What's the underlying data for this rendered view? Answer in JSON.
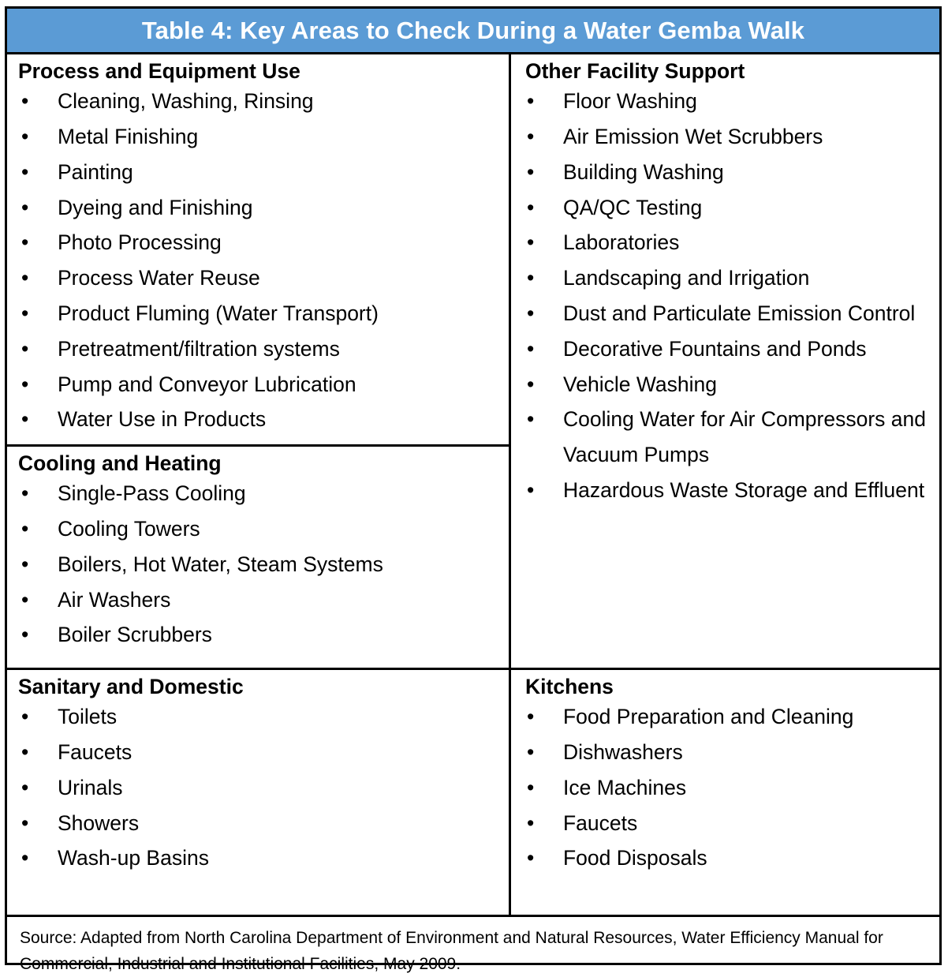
{
  "table": {
    "header": {
      "title": "Table 4: Key Areas to Check During a Water Gemba Walk",
      "background_color": "#5B9BD5",
      "text_color": "#FFFFFF"
    },
    "border_color": "#000000",
    "left_column": [
      {
        "heading": "Process and Equipment Use",
        "items": [
          "Cleaning, Washing, Rinsing",
          "Metal Finishing",
          "Painting",
          "Dyeing and Finishing",
          "Photo Processing",
          "Process Water Reuse",
          "Product Fluming (Water Transport)",
          "Pretreatment/filtration systems",
          "Pump and Conveyor Lubrication",
          "Water Use in Products"
        ]
      },
      {
        "heading": "Cooling and Heating",
        "items": [
          "Single-Pass Cooling",
          "Cooling Towers",
          "Boilers, Hot Water, Steam Systems",
          "Air Washers",
          "Boiler Scrubbers"
        ]
      },
      {
        "heading": "Sanitary and Domestic",
        "items": [
          "Toilets",
          "Faucets",
          "Urinals",
          "Showers",
          "Wash-up Basins"
        ]
      }
    ],
    "right_column": [
      {
        "heading": "Other Facility Support",
        "items": [
          "Floor Washing",
          "Air Emission Wet Scrubbers",
          "Building Washing",
          "QA/QC Testing",
          "Laboratories",
          "Landscaping and Irrigation",
          "Dust and Particulate Emission Control",
          "Decorative Fountains and Ponds",
          "Vehicle Washing",
          "Cooling Water for Air Compressors and Vacuum Pumps",
          "Hazardous Waste Storage and Effluent"
        ]
      },
      {
        "heading": "Kitchens",
        "items": [
          "Food Preparation and Cleaning",
          "Dishwashers",
          "Ice Machines",
          "Faucets",
          "Food Disposals"
        ]
      }
    ],
    "source": "Source: Adapted from North Carolina Department of Environment and Natural Resources, Water Efficiency Manual for Commercial, Industrial and Institutional Facilities, May 2009.",
    "bullet_glyph": "•"
  }
}
